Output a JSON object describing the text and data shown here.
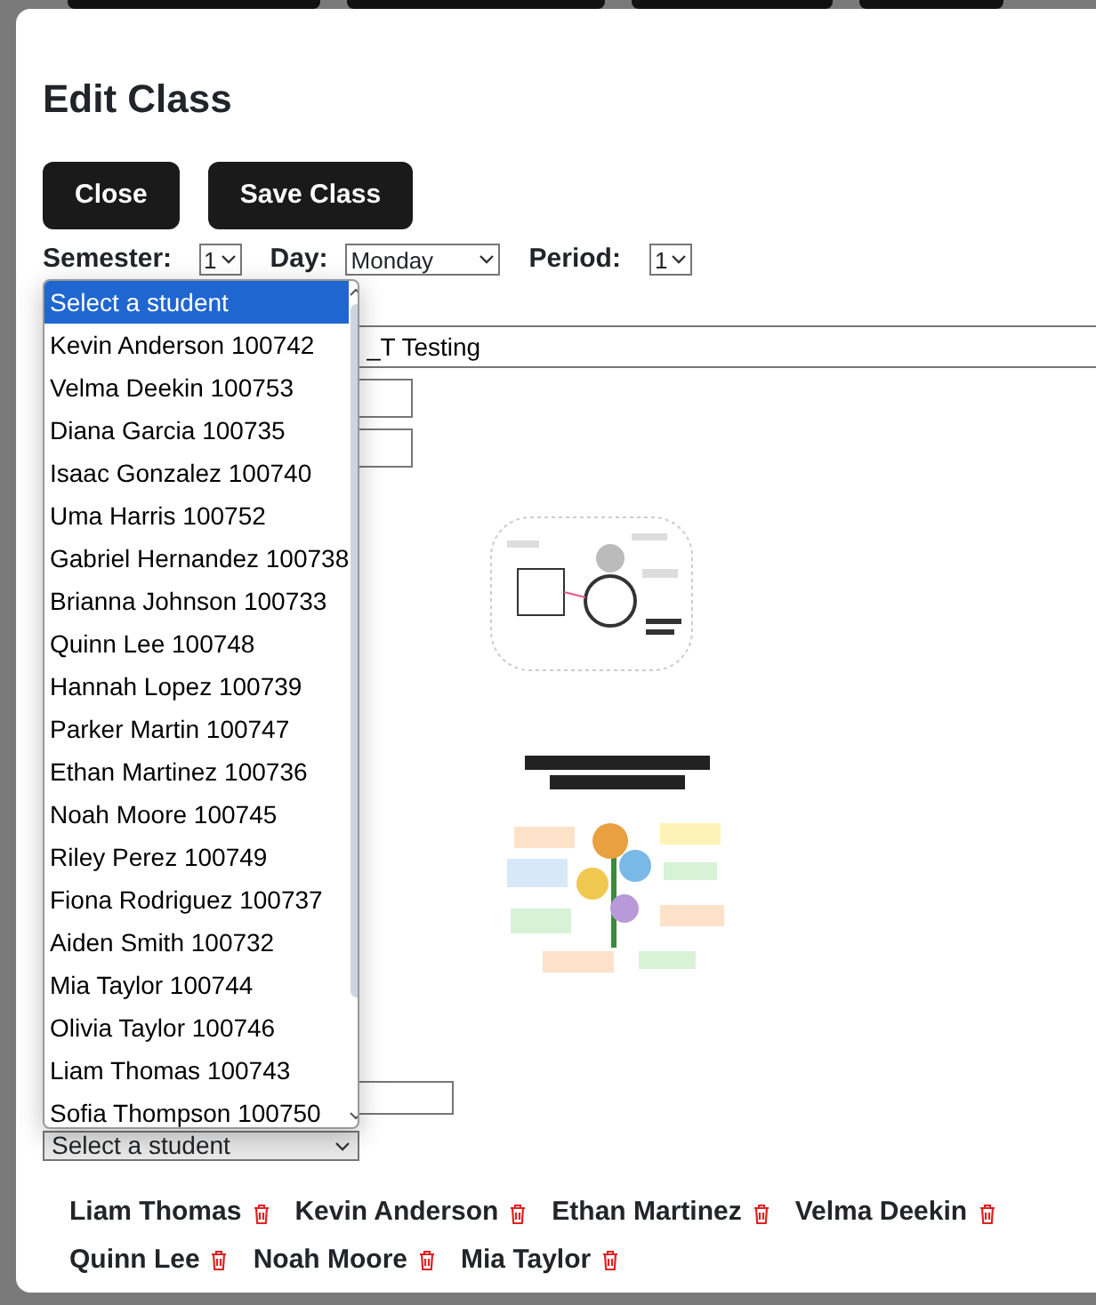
{
  "modal": {
    "title": "Edit Class",
    "buttons": [
      "Close",
      "Save Class"
    ],
    "selects": [
      {
        "label": "Semester:",
        "value": "1"
      },
      {
        "label": "Day:",
        "value": "Monday"
      },
      {
        "label": "Period:",
        "value": "1"
      }
    ],
    "class_name_value": "_T Testing",
    "images": [
      {
        "kind": "picture"
      },
      {
        "kind": "picture"
      }
    ],
    "student_dropdown": {
      "value": "Select a student",
      "expanded": true,
      "options": [
        {
          "label": "Select a student",
          "selected": true
        },
        {
          "label": "Kevin Anderson 100742",
          "selected": false
        },
        {
          "label": "Velma Deekin 100753",
          "selected": false
        },
        {
          "label": "Diana Garcia 100735",
          "selected": false
        },
        {
          "label": "Isaac Gonzalez 100740",
          "selected": false
        },
        {
          "label": "Uma Harris 100752",
          "selected": false
        },
        {
          "label": "Gabriel Hernandez 100738",
          "selected": false
        },
        {
          "label": "Brianna Johnson 100733",
          "selected": false
        },
        {
          "label": "Quinn Lee 100748",
          "selected": false
        },
        {
          "label": "Hannah Lopez 100739",
          "selected": false
        },
        {
          "label": "Parker Martin 100747",
          "selected": false
        },
        {
          "label": "Ethan Martinez 100736",
          "selected": false
        },
        {
          "label": "Noah Moore 100745",
          "selected": false
        },
        {
          "label": "Riley Perez 100749",
          "selected": false
        },
        {
          "label": "Fiona Rodriguez 100737",
          "selected": false
        },
        {
          "label": "Aiden Smith 100732",
          "selected": false
        },
        {
          "label": "Mia Taylor 100744",
          "selected": false
        },
        {
          "label": "Olivia Taylor 100746",
          "selected": false
        },
        {
          "label": "Liam Thomas 100743",
          "selected": false
        },
        {
          "label": "Sofia Thompson 100750",
          "selected": false
        }
      ]
    },
    "enrolled_students": [
      "Liam Thomas",
      "Kevin Anderson",
      "Ethan Martinez",
      "Velma Deekin",
      "Quinn Lee",
      "Noah Moore",
      "Mia Taylor"
    ]
  }
}
